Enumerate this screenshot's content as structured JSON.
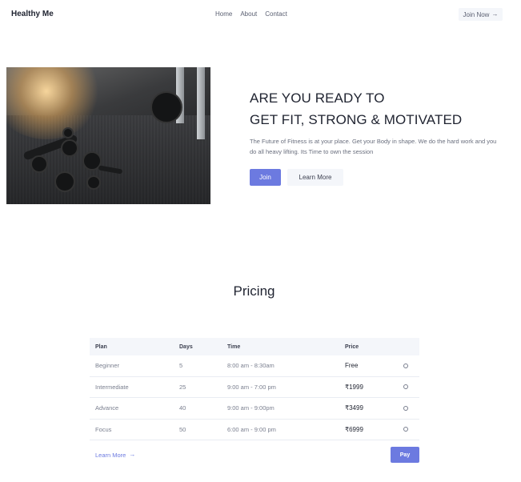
{
  "header": {
    "brand": "Healthy Me",
    "nav": [
      "Home",
      "About",
      "Contact"
    ],
    "join_now": "Join Now",
    "arrow": "→"
  },
  "hero": {
    "title_line1": "ARE YOU READY TO",
    "title_line2": "GET FIT, STRONG & MOTIVATED",
    "description": "The Future of Fitness is at your place. Get your Body in shape. We do the hard work and you do all heavy lifting. Its Time to own the session",
    "join_label": "Join",
    "learn_more_label": "Learn More",
    "image": "gym-dumbbells-photo"
  },
  "pricing": {
    "title": "Pricing",
    "columns": [
      "Plan",
      "Days",
      "Time",
      "Price"
    ],
    "rows": [
      {
        "plan": "Beginner",
        "days": "5",
        "time": "8:00 am - 8:30am",
        "price": "Free"
      },
      {
        "plan": "Intermediate",
        "days": "25",
        "time": "9:00 am - 7:00 pm",
        "price": "₹1999"
      },
      {
        "plan": "Advance",
        "days": "40",
        "time": "9:00 am - 9:00pm",
        "price": "₹3499"
      },
      {
        "plan": "Focus",
        "days": "50",
        "time": "6:00 am - 9:00 pm",
        "price": "₹6999"
      }
    ],
    "learn_more": "Learn More",
    "pay_label": "Pay"
  },
  "colors": {
    "accent": "#6c7ae0",
    "light_bg": "#f4f6fa",
    "text": "#1f2330"
  }
}
